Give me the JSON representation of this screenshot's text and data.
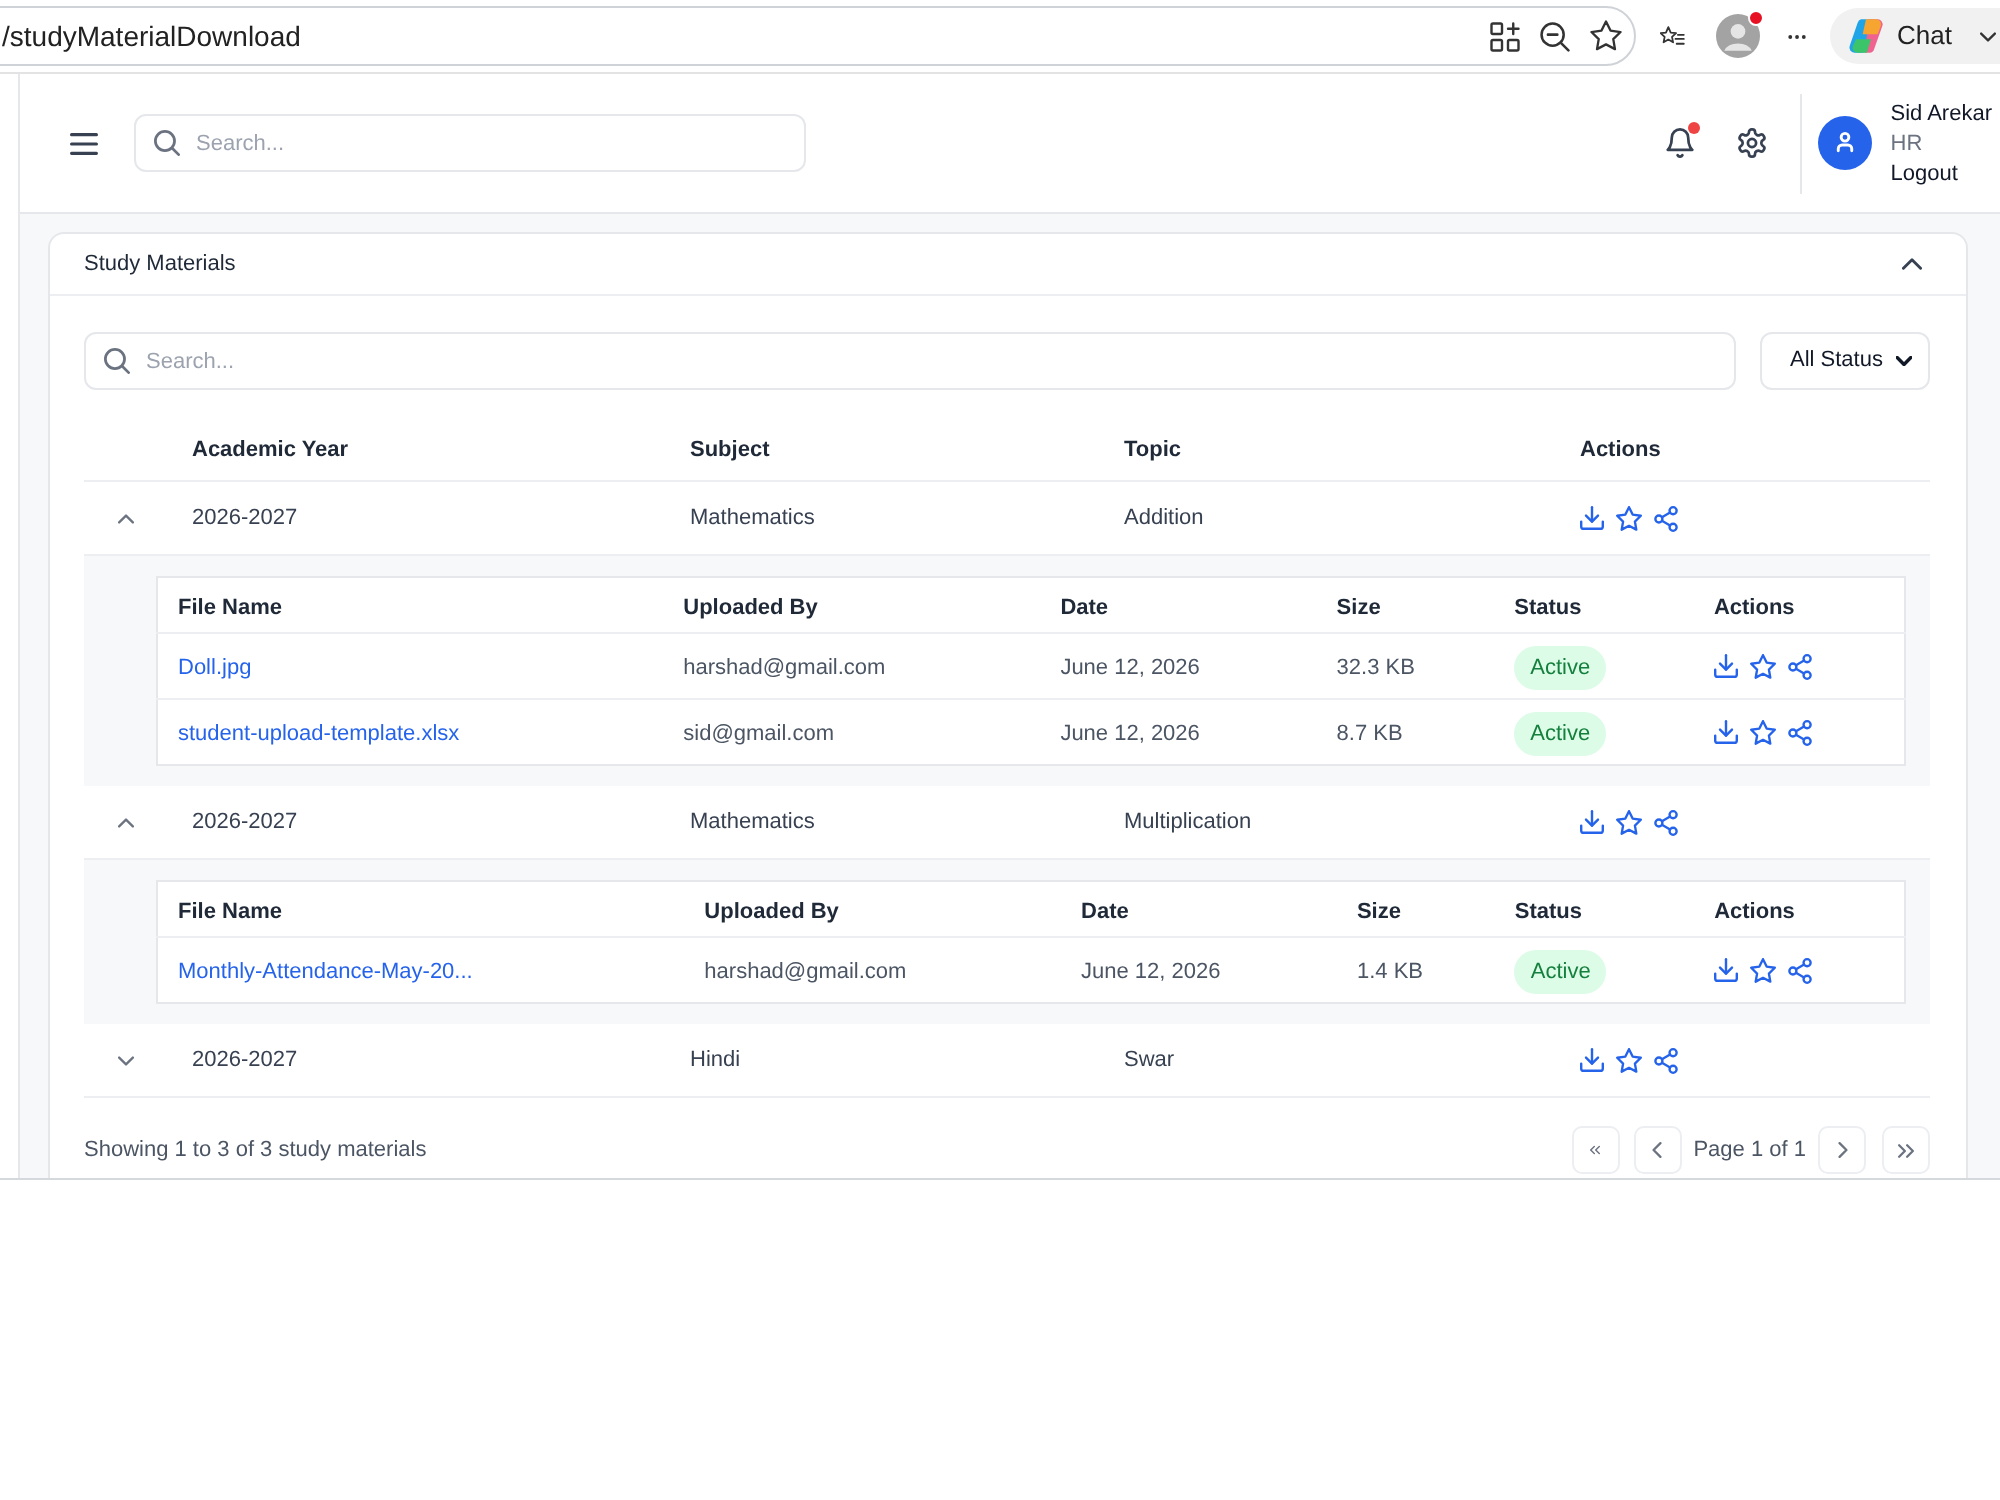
{
  "browser": {
    "url": "/studyMaterialDownload",
    "profile_alert": true,
    "copilot_label": "Chat"
  },
  "header": {
    "search": {
      "placeholder": "Search..."
    },
    "notifications_unread": true,
    "user": {
      "name": "Sid Arekar",
      "role": "HR",
      "logout": "Logout"
    }
  },
  "study_materials": {
    "title": "Study Materials",
    "expanded": true,
    "search": {
      "placeholder": "Search..."
    },
    "status_filter": {
      "value": "All Status"
    },
    "columns": [
      "Academic Year",
      "Subject",
      "Topic",
      "Actions"
    ],
    "rows": [
      {
        "academic_year": "2026-2027",
        "subject": "Mathematics",
        "topic": "Addition",
        "expanded": true,
        "files": {
          "columns": [
            "File Name",
            "Uploaded By",
            "Date",
            "Size",
            "Status",
            "Actions"
          ],
          "rows": [
            {
              "file_name": "Doll.jpg",
              "uploaded_by": "harshad@gmail.com",
              "date": "June 12, 2026",
              "size": "32.3 KB",
              "status": "Active"
            },
            {
              "file_name": "student-upload-template.xlsx",
              "uploaded_by": "sid@gmail.com",
              "date": "June 12, 2026",
              "size": "8.7 KB",
              "status": "Active"
            }
          ]
        }
      },
      {
        "academic_year": "2026-2027",
        "subject": "Mathematics",
        "topic": "Multiplication",
        "expanded": true,
        "files": {
          "columns": [
            "File Name",
            "Uploaded By",
            "Date",
            "Size",
            "Status",
            "Actions"
          ],
          "rows": [
            {
              "file_name": "Monthly-Attendance-May-20...",
              "uploaded_by": "harshad@gmail.com",
              "date": "June 12, 2026",
              "size": "1.4 KB",
              "status": "Active"
            }
          ]
        }
      },
      {
        "academic_year": "2026-2027",
        "subject": "Hindi",
        "topic": "Swar",
        "expanded": false
      }
    ],
    "footer": {
      "summary": "Showing 1 to 3 of 3 study materials",
      "page_label": "Page 1 of 1"
    }
  }
}
